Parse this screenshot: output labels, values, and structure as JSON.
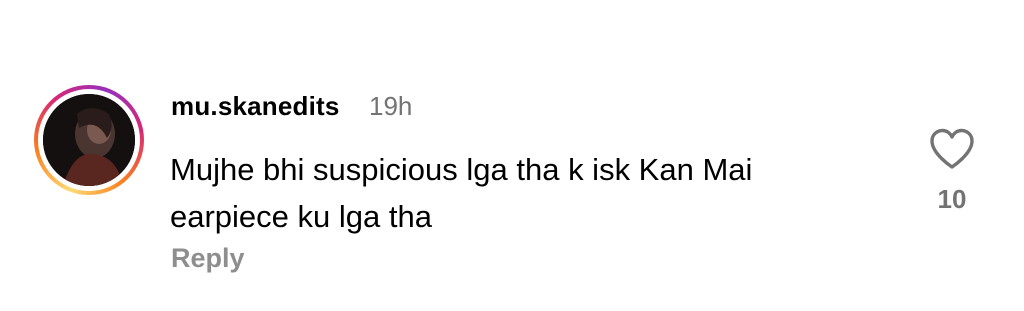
{
  "comment": {
    "username": "mu.skanedits",
    "timestamp": "19h",
    "text_line1": "Mujhe bhi suspicious lga tha k isk Kan Mai",
    "text_line2": "earpiece ku lga tha",
    "reply_label": "Reply",
    "like_count": "10",
    "like_icon": "heart-outline-icon",
    "story_ring_colors": [
      "#feda75",
      "#fa7e1e",
      "#d62976",
      "#962fbf"
    ]
  }
}
